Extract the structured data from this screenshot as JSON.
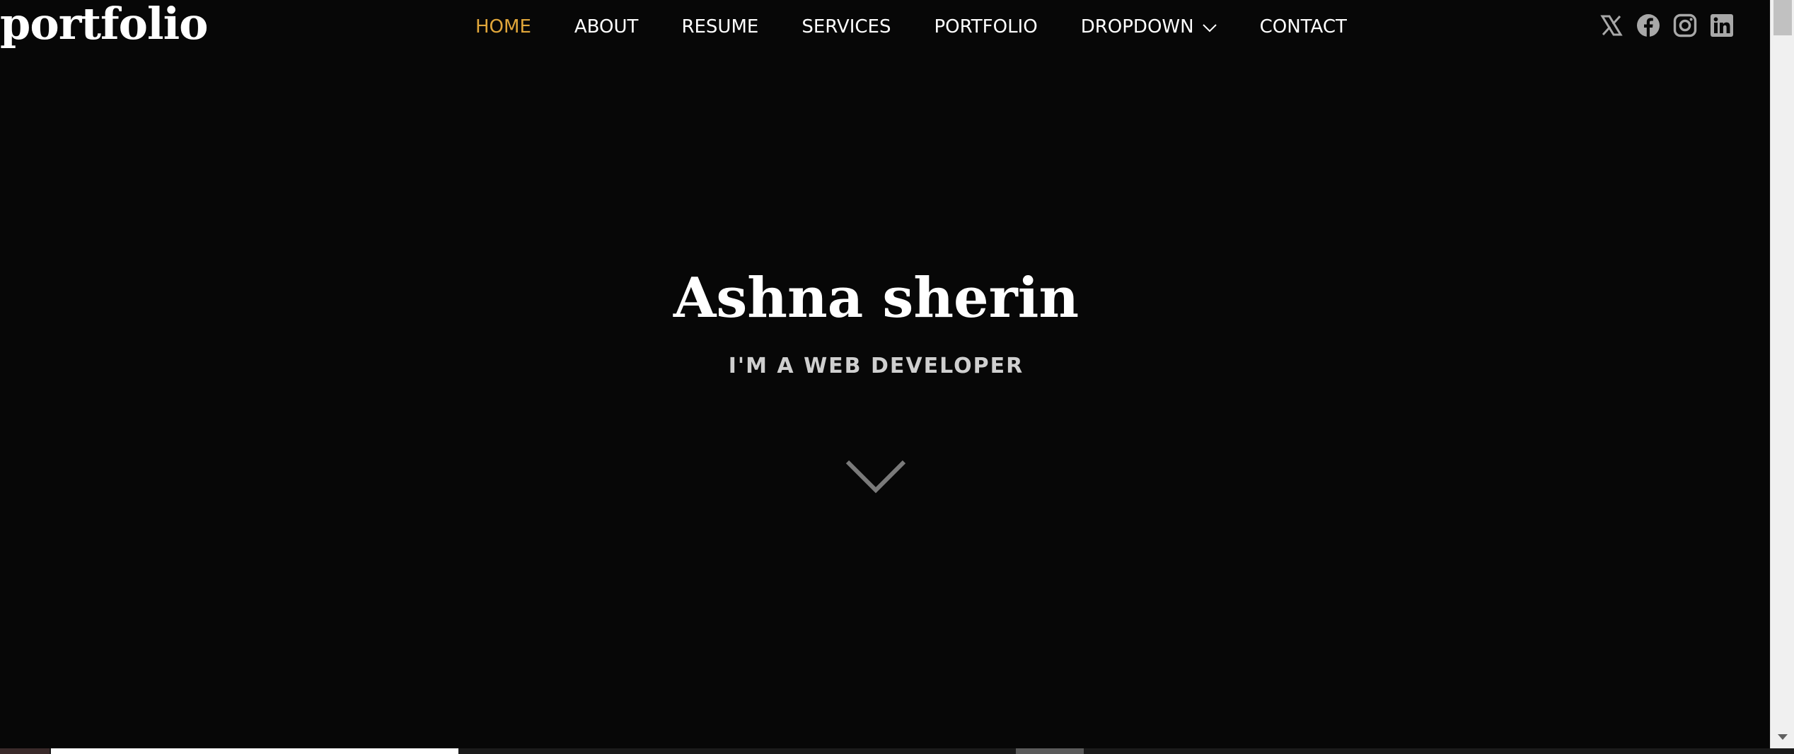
{
  "header": {
    "logo": "portfolio",
    "nav": [
      {
        "label": "HOME",
        "active": true
      },
      {
        "label": "ABOUT",
        "active": false
      },
      {
        "label": "RESUME",
        "active": false
      },
      {
        "label": "SERVICES",
        "active": false
      },
      {
        "label": "PORTFOLIO",
        "active": false
      },
      {
        "label": "DROPDOWN",
        "active": false,
        "has_submenu": true
      },
      {
        "label": "CONTACT",
        "active": false
      }
    ],
    "social_icons": [
      "x-twitter-icon",
      "facebook-icon",
      "instagram-icon",
      "linkedin-icon"
    ]
  },
  "hero": {
    "name": "Ashna sherin",
    "subtitle": "I'M A WEB DEVELOPER",
    "scroll_icon": "chevron-down-icon"
  },
  "colors": {
    "background": "#070707",
    "accent": "#e0a63a",
    "text": "#ffffff",
    "icon_gray": "#a8a8a8"
  }
}
